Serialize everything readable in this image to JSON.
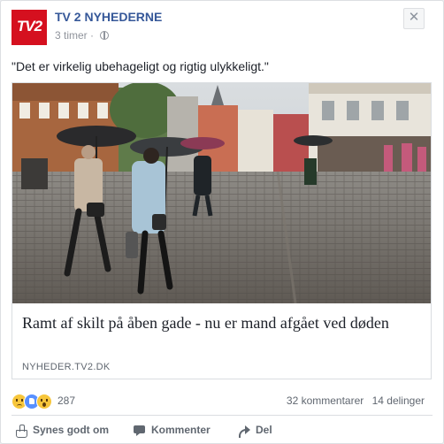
{
  "post": {
    "page_name": "TV 2 NYHEDERNE",
    "logo_text": "TV2",
    "time_ago": "3 timer",
    "separator": "·",
    "close_label": "✕",
    "text": "\"Det er virkelig ubehageligt og rigtig ulykkeligt.\""
  },
  "link": {
    "title": "Ramt af skilt på åben gade - nu er mand afgået ved døden",
    "domain": "NYHEDER.TV2.DK",
    "image_description": "Rainy cobblestone pedestrian street with people holding umbrellas"
  },
  "stats": {
    "reaction_count": "287",
    "comments": "32 kommentarer",
    "shares": "14 delinger"
  },
  "actions": {
    "like": "Synes godt om",
    "comment": "Kommenter",
    "share": "Del"
  },
  "colors": {
    "brand_red": "#d5101f",
    "link_blue": "#365899",
    "muted": "#90949c"
  }
}
